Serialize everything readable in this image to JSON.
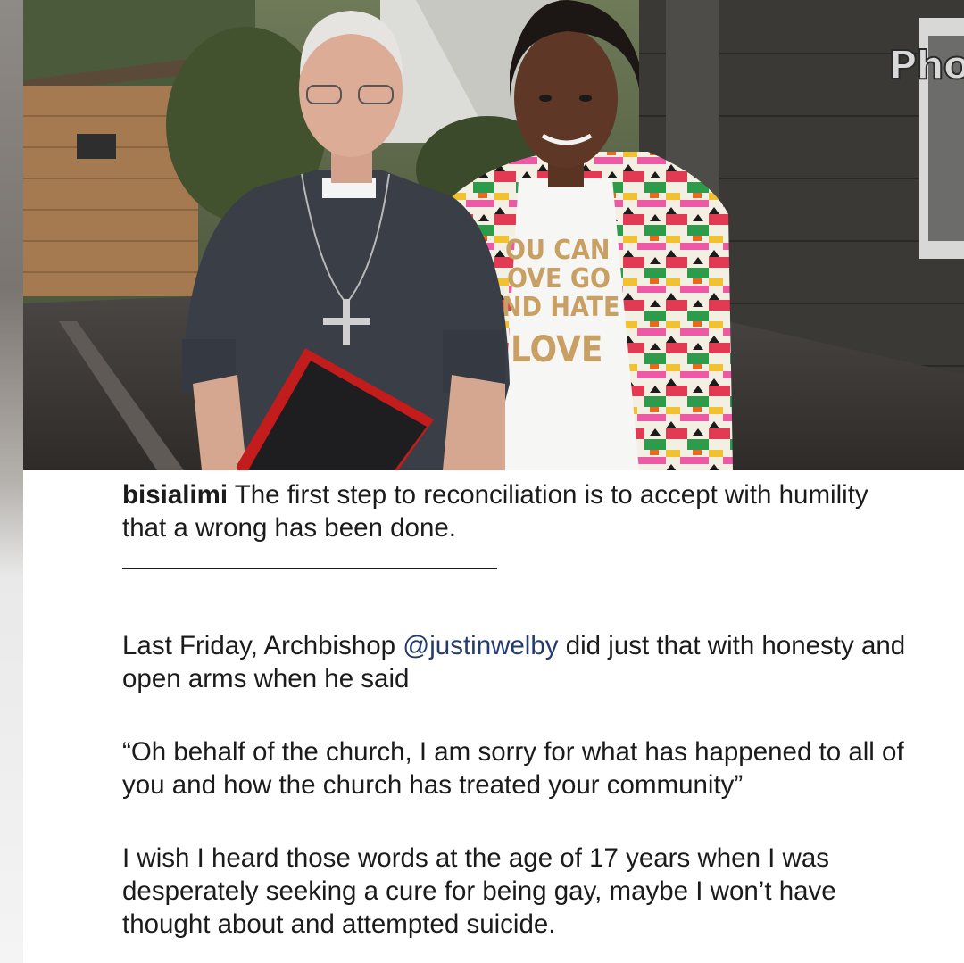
{
  "photo": {
    "corner_label": "Pho",
    "shirt_lines": [
      "OU CAN",
      "OVE GO",
      "ND HATE",
      "LOVE"
    ]
  },
  "post": {
    "username": "bisialimi",
    "intro": " The first step to reconciliation is to accept with humility that a wrong has been done.",
    "para1_before": "Last Friday, Archbishop ",
    "para1_mention": "@justinwelby",
    "para1_after": " did just that with honesty and open arms when he said",
    "quote": "“Oh behalf of the church, I am sorry for what has happened to all of you and how the church has treated your community”",
    "para3": "I wish I heard those words at the age of 17 years when I was desperately seeking a cure for being gay, maybe I won’t have thought about and attempted suicide."
  }
}
